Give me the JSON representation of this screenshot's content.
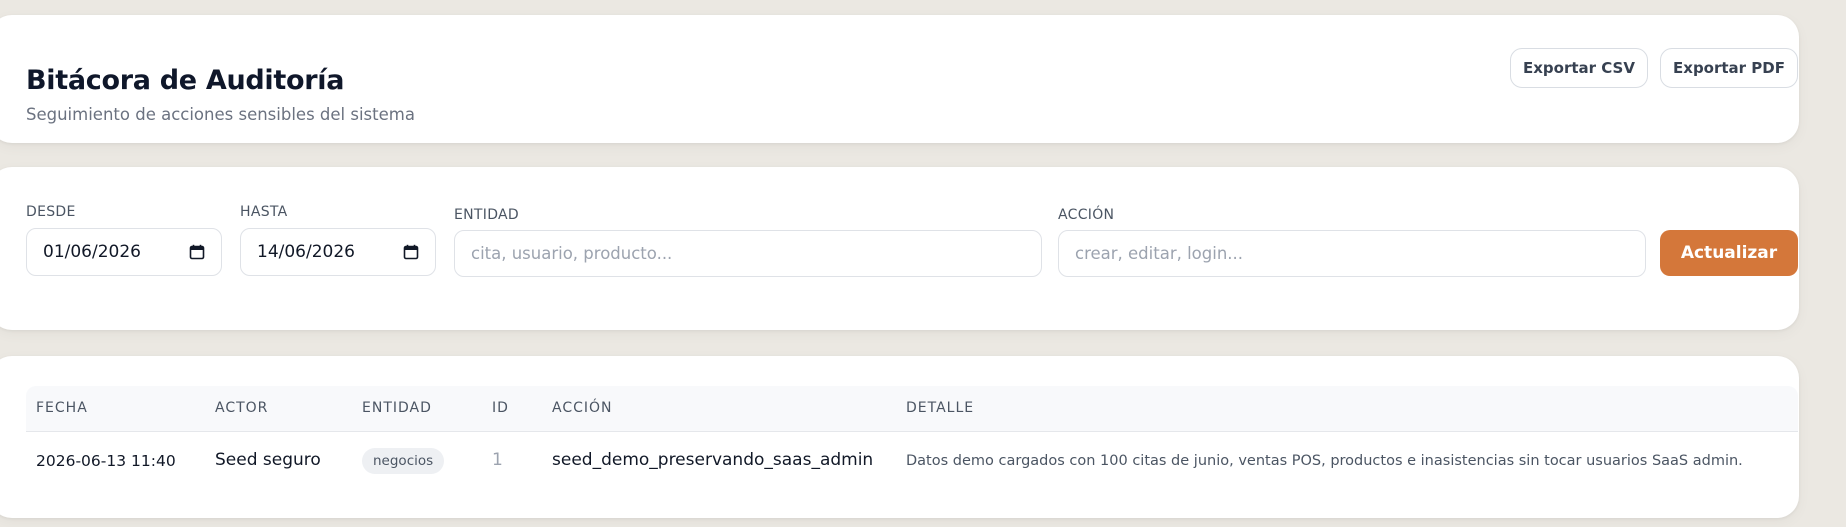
{
  "header": {
    "title": "Bitácora de Auditoría",
    "subtitle": "Seguimiento de acciones sensibles del sistema",
    "export_csv_label": "Exportar CSV",
    "export_pdf_label": "Exportar PDF"
  },
  "filters": {
    "desde": {
      "label": "DESDE",
      "value": "01/06/2026",
      "icon": "calendar-icon"
    },
    "hasta": {
      "label": "HASTA",
      "value": "14/06/2026",
      "icon": "calendar-icon"
    },
    "entidad": {
      "label": "ENTIDAD",
      "placeholder": "cita, usuario, producto..."
    },
    "accion": {
      "label": "ACCIÓN",
      "placeholder": "crear, editar, login..."
    },
    "submit_label": "Actualizar"
  },
  "table": {
    "columns": [
      "FECHA",
      "ACTOR",
      "ENTIDAD",
      "ID",
      "ACCIÓN",
      "DETALLE"
    ],
    "rows": [
      {
        "fecha": "2026-06-13 11:40",
        "actor": "Seed seguro",
        "entidad": "negocios",
        "id": "1",
        "accion": "seed_demo_preservando_saas_admin",
        "detalle": "Datos demo cargados con 100 citas de junio, ventas POS, productos e inasistencias sin tocar usuarios SaaS admin."
      }
    ]
  },
  "colors": {
    "accent": "#d4773a",
    "background": "#ebe8e2",
    "card": "#ffffff"
  }
}
